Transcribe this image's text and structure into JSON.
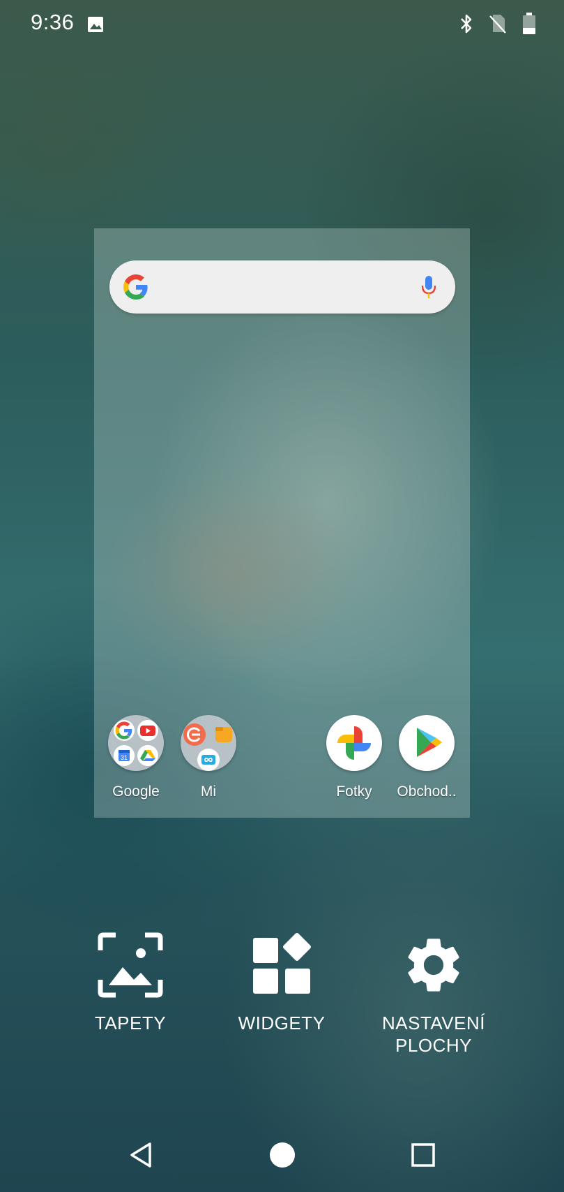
{
  "status_bar": {
    "time": "9:36",
    "left_icons": [
      "image-notification-icon"
    ],
    "right_icons": [
      "bluetooth-icon",
      "no-sim-icon",
      "battery-icon"
    ]
  },
  "preview": {
    "search_bar": {
      "logo_icon": "google-g-icon",
      "mic_icon": "microphone-icon"
    },
    "apps": [
      {
        "label": "Google",
        "icon": "google-folder-icon"
      },
      {
        "label": "Mi",
        "icon": "mi-folder-icon"
      },
      {
        "label": "Fotky",
        "icon": "google-photos-icon"
      },
      {
        "label": "Obchod..",
        "icon": "play-store-icon"
      }
    ]
  },
  "options": {
    "wallpapers": {
      "label": "TAPETY",
      "icon": "wallpaper-icon"
    },
    "widgets": {
      "label": "WIDGETY",
      "icon": "widgets-icon"
    },
    "settings": {
      "label": "NASTAVENÍ\nPLOCHY",
      "icon": "gear-icon"
    }
  },
  "nav_bar": {
    "icons": [
      "back-icon",
      "home-icon",
      "recents-icon"
    ]
  },
  "colors": {
    "google_blue": "#4285F4",
    "google_red": "#EA4335",
    "google_yellow": "#FBBC05",
    "google_green": "#34A853"
  }
}
